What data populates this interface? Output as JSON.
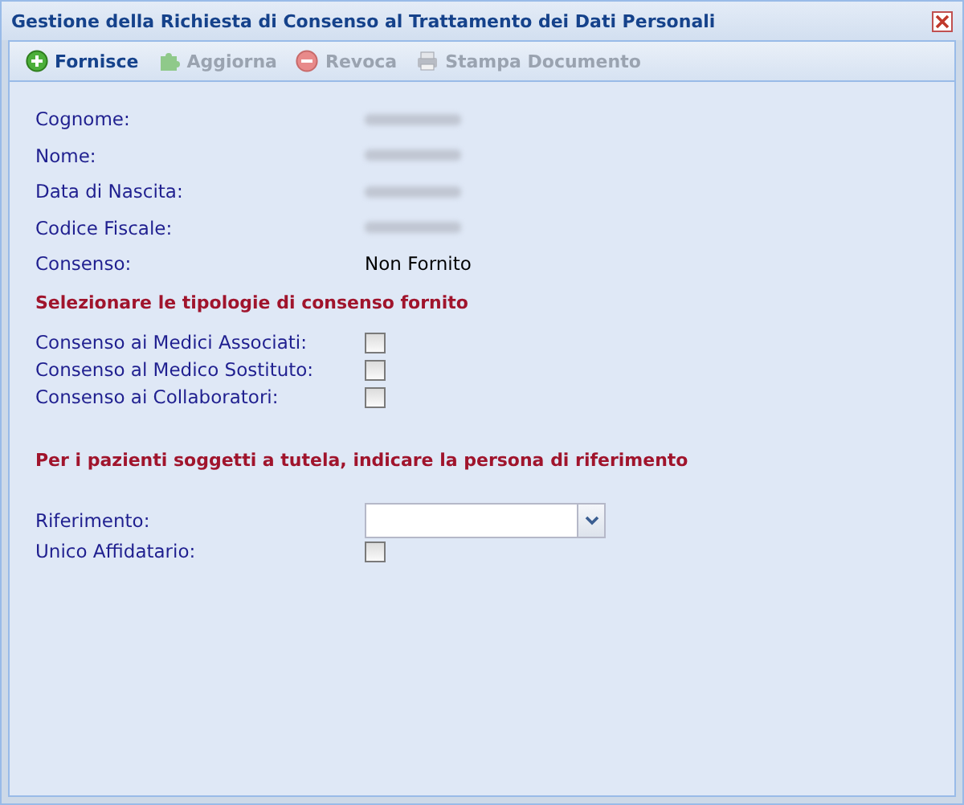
{
  "window": {
    "title": "Gestione della Richiesta di Consenso al Trattamento dei Dati Personali"
  },
  "toolbar": [
    {
      "kind": "add",
      "label": "Fornisce",
      "disabled": false
    },
    {
      "kind": "puzzle",
      "label": "Aggiorna",
      "disabled": true
    },
    {
      "kind": "remove",
      "label": "Revoca",
      "disabled": true
    },
    {
      "kind": "print",
      "label": "Stampa Documento",
      "disabled": true
    }
  ],
  "fields": [
    {
      "label": "Cognome:",
      "kind": "hidden"
    },
    {
      "label": "Nome:",
      "kind": "hidden"
    },
    {
      "label": "Data di Nascita:",
      "kind": "hidden"
    },
    {
      "label": "Codice Fiscale:",
      "kind": "hidden"
    },
    {
      "label": "Consenso:",
      "kind": "text",
      "value": "Non Fornito"
    }
  ],
  "consent_heading": "Selezionare le tipologie di consenso fornito",
  "consents": [
    {
      "label": "Consenso ai Medici Associati:",
      "checked": false
    },
    {
      "label": "Consenso al Medico Sostituto:",
      "checked": false
    },
    {
      "label": "Consenso ai Collaboratori:",
      "checked": false
    }
  ],
  "guardian_heading": "Per i pazienti soggetti a tutela, indicare la persona di riferimento",
  "reference": {
    "label": "Riferimento:"
  },
  "sole_custodian": {
    "label": "Unico Affidatario:",
    "checked": false
  }
}
